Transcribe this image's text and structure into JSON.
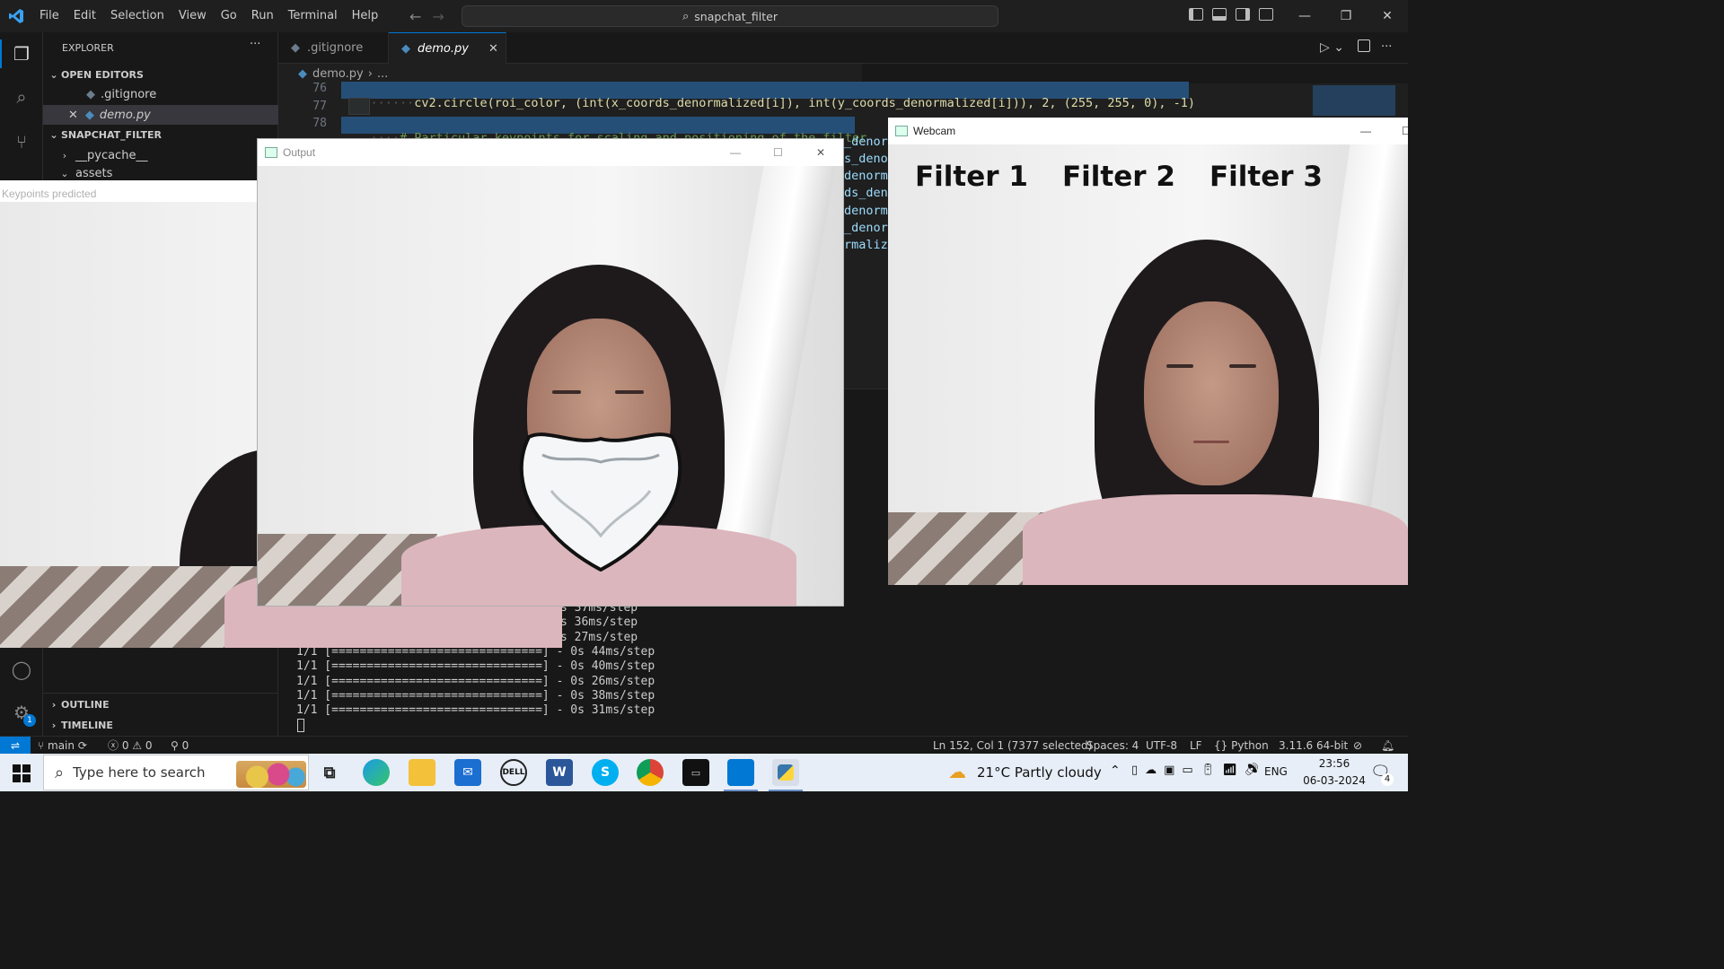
{
  "vscode": {
    "menu": [
      "File",
      "Edit",
      "Selection",
      "View",
      "Go",
      "Run",
      "Terminal",
      "Help"
    ],
    "search": "snapchat_filter",
    "explorer_title": "EXPLORER",
    "open_editors": "OPEN EDITORS",
    "open_files": [
      ".gitignore",
      "demo.py"
    ],
    "project": "SNAPCHAT_FILTER",
    "folders": [
      "__pycache__",
      "assets"
    ],
    "outline": "OUTLINE",
    "timeline": "TIMELINE",
    "tabs": [
      ".gitignore",
      "demo.py"
    ],
    "breadcrumb": [
      "demo.py",
      "..."
    ],
    "line_numbers": [
      "76",
      "77",
      "78"
    ],
    "code": {
      "l76": "cv2.circle(roi_color, (int(x_coords_denormalized[i]), int(y_coords_denormalized[i])), 2, (255, 255, 0), -1)",
      "l78": "# Particular keypoints for scaling and positioning of the filter",
      "overflow": [
        "_denorm",
        "s_denor",
        "denorma",
        "ds_deno",
        "denorma",
        "_denorm",
        "rmalize"
      ]
    },
    "terminal": {
      "partial": [
        "s 37ms/step",
        "s 36ms/step",
        "s 27ms/step"
      ],
      "lines": [
        "1/1 [==============================] - 0s 44ms/step",
        "1/1 [==============================] - 0s 40ms/step",
        "1/1 [==============================] - 0s 26ms/step",
        "1/1 [==============================] - 0s 38ms/step",
        "1/1 [==============================] - 0s 31ms/step"
      ]
    },
    "status": {
      "branch": "main",
      "errors": "0",
      "warnings": "0",
      "ports": "0",
      "position": "Ln 152, Col 1 (7377 selected)",
      "spaces": "Spaces: 4",
      "encoding": "UTF-8",
      "eol": "LF",
      "language": "Python",
      "interpreter": "3.11.6 64-bit",
      "settings_badge": "1"
    }
  },
  "windows": {
    "keypoints_title": "Keypoints predicted",
    "output_title": "Output",
    "webcam_title": "Webcam",
    "filters": [
      "Filter 1",
      "Filter 2",
      "Filter 3"
    ]
  },
  "taskbar": {
    "search_placeholder": "Type here to search",
    "weather": "21°C  Partly cloudy",
    "lang": "ENG",
    "time": "23:56",
    "date": "06-03-2024",
    "notif_count": "4"
  },
  "colors": {
    "accent": "#0078d4",
    "code_fn": "#dcdcaa",
    "code_var": "#9cdcfe",
    "code_num": "#b5cea8",
    "code_comment": "#6a9955"
  }
}
